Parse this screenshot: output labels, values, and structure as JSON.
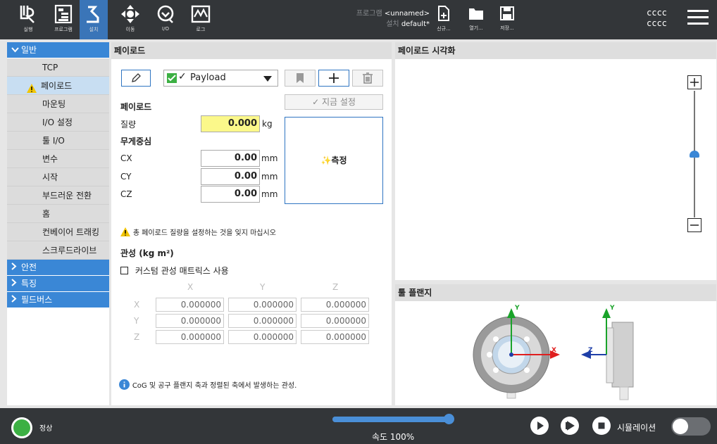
{
  "topbar": {
    "nav": [
      {
        "label": "실행",
        "icon": "run-icon"
      },
      {
        "label": "프로그램",
        "icon": "program-icon"
      },
      {
        "label": "설치",
        "icon": "installation-icon"
      },
      {
        "label": "이동",
        "icon": "move-icon"
      },
      {
        "label": "I/O",
        "icon": "io-icon"
      },
      {
        "label": "로그",
        "icon": "log-icon"
      }
    ],
    "program_label": "프로그램",
    "program_value": "<unnamed>",
    "install_label": "설치",
    "install_value": "default*",
    "file_buttons": [
      {
        "label": "신규...",
        "icon": "new-file-icon"
      },
      {
        "label": "열기...",
        "icon": "open-folder-icon"
      },
      {
        "label": "저장...",
        "icon": "save-icon"
      }
    ],
    "user_line1": "cccc",
    "user_line2": "cccc"
  },
  "sidebar": {
    "general": "일반",
    "items": [
      "TCP",
      "페이로드",
      "마운팅",
      "I/O 설정",
      "툴 I/O",
      "변수",
      "시작",
      "부드러운 전환",
      "홈",
      "컨베이어 트래킹",
      "스크루드라이브"
    ],
    "selected_index": 1,
    "collapsed_sections": [
      "안전",
      "특징",
      "필드버스"
    ]
  },
  "payload": {
    "title": "페이로드",
    "dropdown_value": "Payload",
    "set_now": "지금 설정",
    "section_payload": "페이로드",
    "mass_label": "질량",
    "mass_value": "0.000",
    "mass_unit": "kg",
    "cog_label": "무게중심",
    "cx_label": "CX",
    "cx_value": "0.00",
    "cy_label": "CY",
    "cy_value": "0.00",
    "cz_label": "CZ",
    "cz_value": "0.00",
    "length_unit": "mm",
    "measure": "측정",
    "warning": "총 페이로드 질량을 설정하는 것을 잊지 마십시오",
    "inertia_title": "관성 (kg m²)",
    "custom_inertia": "커스텀 관성 매트릭스 사용",
    "matrix_cols": [
      "X",
      "Y",
      "Z"
    ],
    "matrix_rows": [
      {
        "label": "X",
        "values": [
          "0.000000",
          "0.000000",
          "0.000000"
        ]
      },
      {
        "label": "Y",
        "values": [
          "0.000000",
          "0.000000",
          "0.000000"
        ]
      },
      {
        "label": "Z",
        "values": [
          "0.000000",
          "0.000000",
          "0.000000"
        ]
      }
    ],
    "info": "CoG 및 공구 플랜지 축과 정렬된 축에서 발생하는 관성."
  },
  "viz": {
    "title": "페이로드 시각화",
    "zoom_level": 0.5
  },
  "flange": {
    "title": "툴 플랜지",
    "axis_x": "X",
    "axis_y": "Y",
    "axis_z": "Z"
  },
  "footer": {
    "status": "정상",
    "speed_label": "속도 100%",
    "speed_fraction": 1.0,
    "simulation": "시뮬레이션"
  },
  "colors": {
    "accent": "#3a87d6",
    "topbar": "#333639",
    "mass_highlight": "#fbf88a",
    "status_ok": "#3cb043"
  }
}
